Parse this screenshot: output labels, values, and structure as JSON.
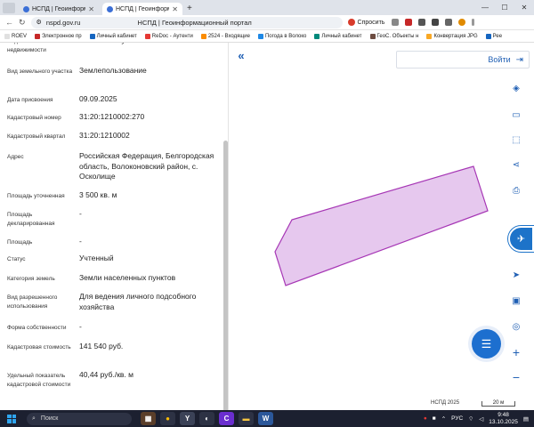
{
  "browser": {
    "tabs": [
      {
        "label": "НСПД | Геоинформаци",
        "active": false
      },
      {
        "label": "НСПД | Геоинформаци",
        "active": true
      }
    ],
    "new_tab": "+",
    "url_host": "nspd.gov.ru",
    "page_title": "НСПД | Геоинформационный портал",
    "assistant_label": "Спросить",
    "bookmarks": [
      {
        "label": "ROEV",
        "color": "#e0e0e0"
      },
      {
        "label": "Электронное пр",
        "color": "#c62828"
      },
      {
        "label": "Личный кабинет",
        "color": "#1565c0"
      },
      {
        "label": "ReDoc - Аутенти",
        "color": "#e53935"
      },
      {
        "label": "2524 - Входящие",
        "color": "#fb8c00"
      },
      {
        "label": "Погода в Волоко",
        "color": "#1e88e5"
      },
      {
        "label": "Личный кабинет",
        "color": "#00897b"
      },
      {
        "label": "ГеоС. Объекты н",
        "color": "#6d4c41"
      },
      {
        "label": "Конвертация JPG",
        "color": "#f9a825"
      },
      {
        "label": "Рее",
        "color": "#1565c0"
      }
    ]
  },
  "panel": {
    "rows": [
      {
        "label": "Вид объекта недвижимости",
        "value": "Земельный участок"
      },
      {
        "label": "Вид земельного участка",
        "value": "Землепользование"
      },
      {
        "label": "Дата присвоения",
        "value": "09.09.2025"
      },
      {
        "label": "Кадастровый номер",
        "value": "31:20:1210002:270"
      },
      {
        "label": "Кадастровый квартал",
        "value": "31:20:1210002"
      },
      {
        "label": "Адрес",
        "value": "Российская Федерация, Белгородская область, Волоконовский район, с. Осколище"
      },
      {
        "label": "Площадь уточненная",
        "value": "3 500 кв. м"
      },
      {
        "label": "Площадь декларированная",
        "value": "-"
      },
      {
        "label": "Площадь",
        "value": "-"
      },
      {
        "label": "Статус",
        "value": "Учтенный"
      },
      {
        "label": "Категория земель",
        "value": "Земли населенных пунктов"
      },
      {
        "label": "Вид разрешенного использования",
        "value": "Для ведения личного подсобного хозяйства"
      },
      {
        "label": "Форма собственности",
        "value": "-"
      },
      {
        "label": "Кадастровая стоимость",
        "value": "141 540 руб."
      },
      {
        "label": "Удельный показатель кадастровой стоимости",
        "value": "40,44 руб./кв. м"
      }
    ]
  },
  "map": {
    "login_label": "Войти",
    "attribution": "НСПД 2025",
    "scale": "20 м",
    "parcel_fill": "#e6c8ee",
    "parcel_stroke": "#a636b5"
  },
  "taskbar": {
    "search_placeholder": "Поиск",
    "lang": "РУС",
    "time": "9:48",
    "date": "13.10.2025"
  },
  "colors": {
    "accent": "#1f5fb4",
    "taskbar": "#1c2030"
  }
}
